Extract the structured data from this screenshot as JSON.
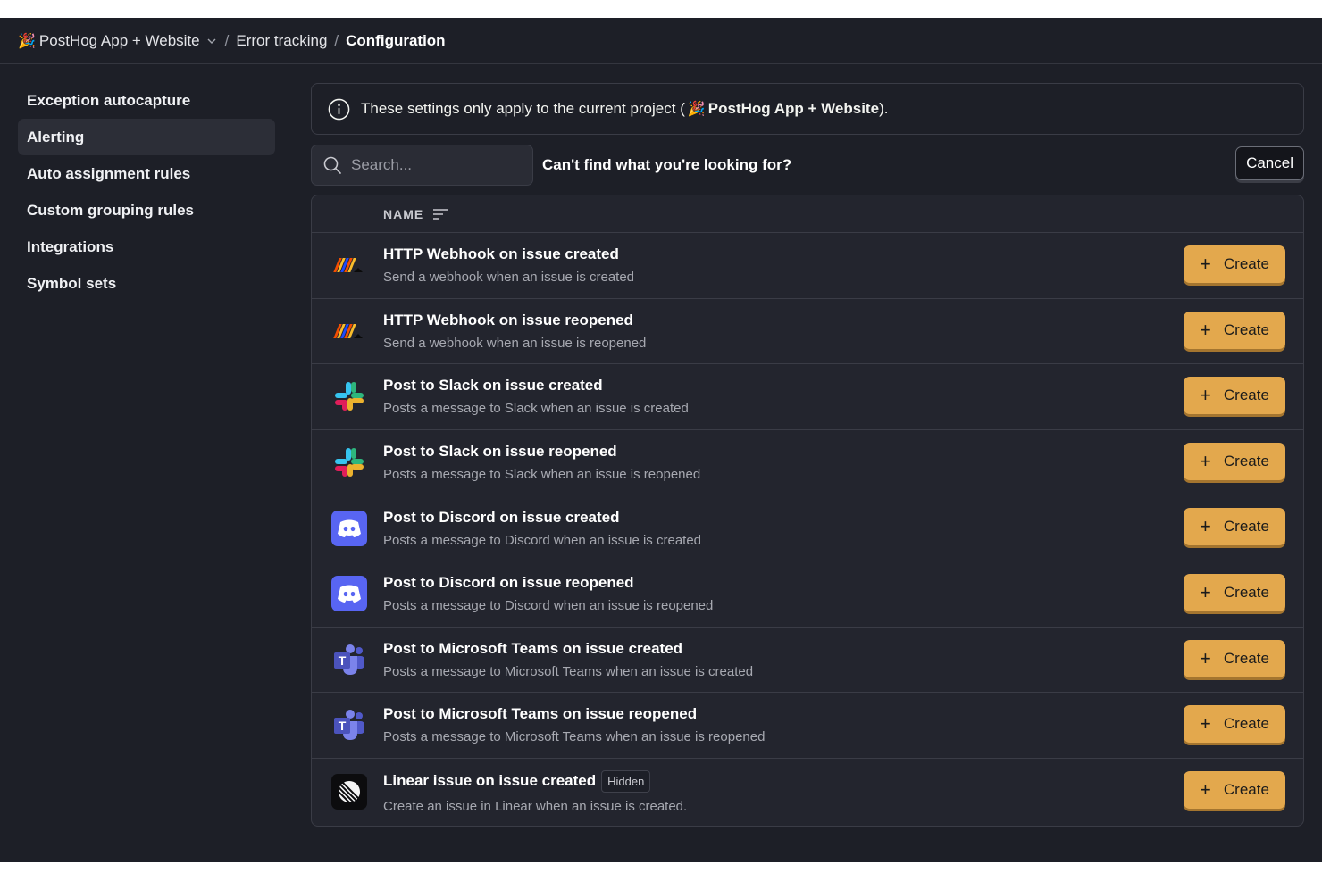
{
  "breadcrumb": {
    "project": "PostHog App + Website",
    "section": "Error tracking",
    "current": "Configuration"
  },
  "sidebar": {
    "items": [
      {
        "label": "Exception autocapture",
        "active": false
      },
      {
        "label": "Alerting",
        "active": true
      },
      {
        "label": "Auto assignment rules",
        "active": false
      },
      {
        "label": "Custom grouping rules",
        "active": false
      },
      {
        "label": "Integrations",
        "active": false
      },
      {
        "label": "Symbol sets",
        "active": false
      }
    ]
  },
  "notice": {
    "prefix": "These settings only apply to the current project (",
    "project": "PostHog App + Website",
    "suffix": ")."
  },
  "search": {
    "placeholder": "Search..."
  },
  "cant_find": "Can't find what you're looking for?",
  "cancel_label": "Cancel",
  "table": {
    "header_name": "NAME",
    "create_label": "Create",
    "rows": [
      {
        "icon": "webhook",
        "title": "HTTP Webhook on issue created",
        "desc": "Send a webhook when an issue is created"
      },
      {
        "icon": "webhook",
        "title": "HTTP Webhook on issue reopened",
        "desc": "Send a webhook when an issue is reopened"
      },
      {
        "icon": "slack",
        "title": "Post to Slack on issue created",
        "desc": "Posts a message to Slack when an issue is created"
      },
      {
        "icon": "slack",
        "title": "Post to Slack on issue reopened",
        "desc": "Posts a message to Slack when an issue is reopened"
      },
      {
        "icon": "discord",
        "title": "Post to Discord on issue created",
        "desc": "Posts a message to Discord when an issue is created"
      },
      {
        "icon": "discord",
        "title": "Post to Discord on issue reopened",
        "desc": "Posts a message to Discord when an issue is reopened"
      },
      {
        "icon": "teams",
        "title": "Post to Microsoft Teams on issue created",
        "desc": "Posts a message to Microsoft Teams when an issue is created"
      },
      {
        "icon": "teams",
        "title": "Post to Microsoft Teams on issue reopened",
        "desc": "Posts a message to Microsoft Teams when an issue is reopened"
      },
      {
        "icon": "linear",
        "title": "Linear issue on issue created",
        "desc": "Create an issue in Linear when an issue is created.",
        "badge": "Hidden"
      }
    ]
  },
  "colors": {
    "background": "#1d1f27",
    "accent_button": "#e3a84d",
    "active_nav": "#2c2e37"
  }
}
